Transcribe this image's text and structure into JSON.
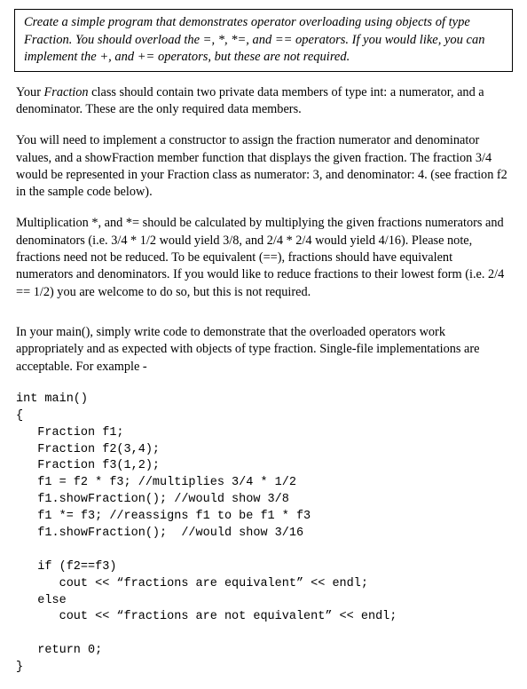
{
  "box_text": "Create a simple program that demonstrates operator overloading using objects of type Fraction. You should overload the =, *, *=, and == operators. If you would like, you can implement the +, and += operators, but these are not required.",
  "para1_a": "Your ",
  "para1_frac": "Fraction",
  "para1_b": " class should contain two private data members of type int:  a numerator, and a denominator.  These are the only required data members.",
  "para2": "You will need to implement a constructor to assign the fraction numerator and denominator values, and a showFraction member function that displays the given fraction.  The fraction 3/4 would be represented in your Fraction class as numerator: 3, and denominator: 4. (see fraction f2 in the sample code below).",
  "para3": "Multiplication *, and *= should be calculated by multiplying the given fractions numerators and denominators (i.e. 3/4 * 1/2 would yield 3/8, and 2/4 * 2/4 would yield 4/16).  Please note, fractions need not be reduced.  To be equivalent (==), fractions should have equivalent numerators and denominators.  If you would like to reduce fractions to their lowest form (i.e. 2/4 == 1/2) you are welcome to do so, but this is not required.",
  "para4": "In your main(), simply write code to demonstrate that the overloaded operators work appropriately and as expected with objects of type fraction.  Single-file implementations are acceptable.  For example -",
  "code": "int main()\n{\n   Fraction f1;\n   Fraction f2(3,4);\n   Fraction f3(1,2);\n   f1 = f2 * f3; //multiplies 3/4 * 1/2\n   f1.showFraction(); //would show 3/8\n   f1 *= f3; //reassigns f1 to be f1 * f3\n   f1.showFraction();  //would show 3/16\n\n   if (f2==f3)\n      cout << “fractions are equivalent” << endl;\n   else\n      cout << “fractions are not equivalent” << endl;\n\n   return 0;\n}"
}
